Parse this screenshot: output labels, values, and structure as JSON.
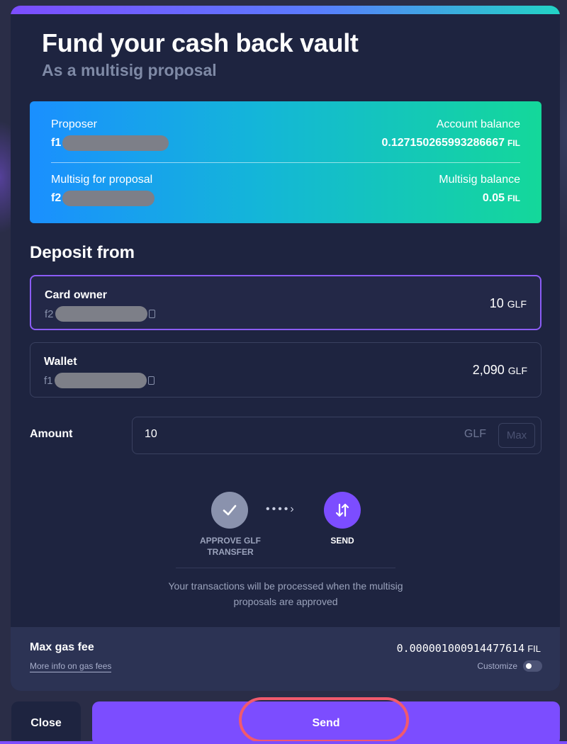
{
  "modal": {
    "title": "Fund your cash back vault",
    "subtitle": "As a multisig proposal"
  },
  "summary": {
    "proposer_label": "Proposer",
    "proposer_prefix": "f1",
    "account_balance_label": "Account balance",
    "account_balance_value": "0.127150265993286667",
    "account_balance_unit": "FIL",
    "multisig_label": "Multisig for proposal",
    "multisig_prefix": "f2",
    "multisig_balance_label": "Multisig balance",
    "multisig_balance_value": "0.05",
    "multisig_balance_unit": "FIL"
  },
  "deposit": {
    "title": "Deposit from",
    "sources": [
      {
        "name": "Card owner",
        "address_prefix": "f2",
        "amount": "10",
        "unit": "GLF",
        "selected": true
      },
      {
        "name": "Wallet",
        "address_prefix": "f1",
        "amount": "2,090",
        "unit": "GLF",
        "selected": false
      }
    ]
  },
  "amount": {
    "label": "Amount",
    "value": "10",
    "unit": "GLF",
    "max_label": "Max"
  },
  "steps": {
    "step1_label": "APPROVE GLF TRANSFER",
    "step2_label": "SEND",
    "info": "Your transactions will be processed when the multisig proposals are approved"
  },
  "gas": {
    "label": "Max gas fee",
    "link": "More info on gas fees",
    "value": "0.000001000914477614",
    "unit": "FIL",
    "customize_label": "Customize"
  },
  "footer": {
    "close_label": "Close",
    "send_label": "Send"
  },
  "colors": {
    "accent": "#7c4dff",
    "highlight": "#f15a6d",
    "background": "#1e2440"
  }
}
